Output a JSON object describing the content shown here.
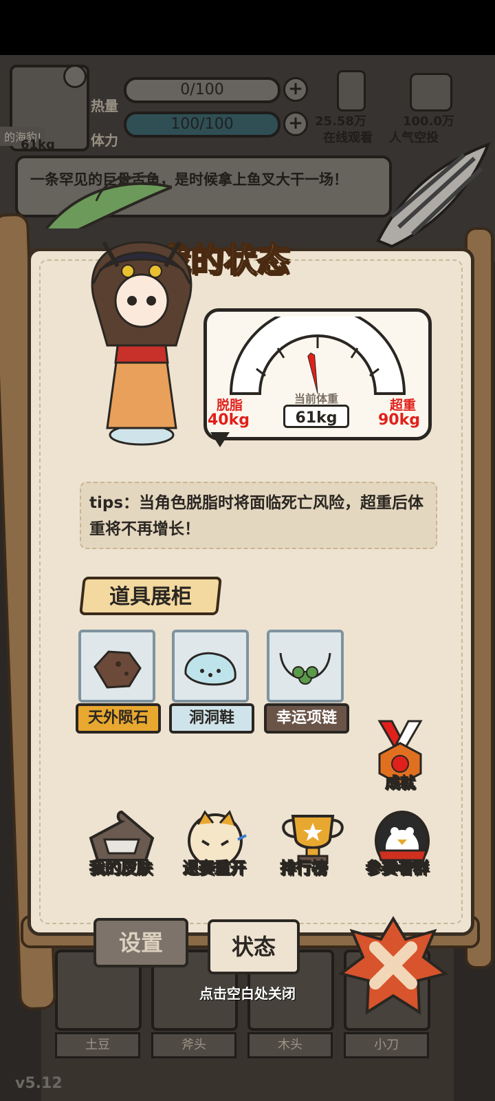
{
  "hud": {
    "heat_label": "热量",
    "heat_value": "0/100",
    "stamina_label": "体力",
    "stamina_value": "100/100",
    "weight_badge": "61kg",
    "seal_tag": "的海豹!",
    "viewers_value": "25.58万",
    "viewers_label": "在线观看",
    "popularity_value": "100.0万",
    "popularity_label": "人气空投"
  },
  "news": "一条罕见的巨骨舌鱼，是时候拿上鱼叉大干一场！",
  "panel": {
    "title": "我的状态",
    "scale": {
      "min_label": "脱脂",
      "min_value": "40kg",
      "max_label": "超重",
      "max_value": "90kg",
      "current_label": "当前体重",
      "current_value": "61kg",
      "current_kg": 61,
      "min_kg": 40,
      "max_kg": 90
    },
    "tips": "tips：当角色脱脂时将面临死亡风险，超重后体重将不再增长！",
    "props_title": "道具展柜",
    "props": [
      {
        "name": "天外陨石",
        "icon": "meteorite-icon"
      },
      {
        "name": "洞洞鞋",
        "icon": "clog-shoe-icon"
      },
      {
        "name": "幸运项链",
        "icon": "clover-necklace-icon"
      }
    ],
    "achievement_label": "成就",
    "actions": [
      {
        "label": "我的皮肤",
        "icon": "clothes-hanger-icon"
      },
      {
        "label": "退赛重开",
        "icon": "crying-girl-icon"
      },
      {
        "label": "排行榜",
        "icon": "trophy-icon"
      },
      {
        "label": "参赛者群",
        "icon": "penguin-icon"
      }
    ]
  },
  "tabs": {
    "settings": "设置",
    "status": "状态"
  },
  "close_hint": "点击空白处关闭",
  "background_items": [
    "土豆",
    "斧头",
    "木头",
    "小刀"
  ],
  "version": "v5.12",
  "colors": {
    "accent_red": "#e0201a",
    "panel_bg": "#ede3d0",
    "wood": "#8a6a47"
  }
}
